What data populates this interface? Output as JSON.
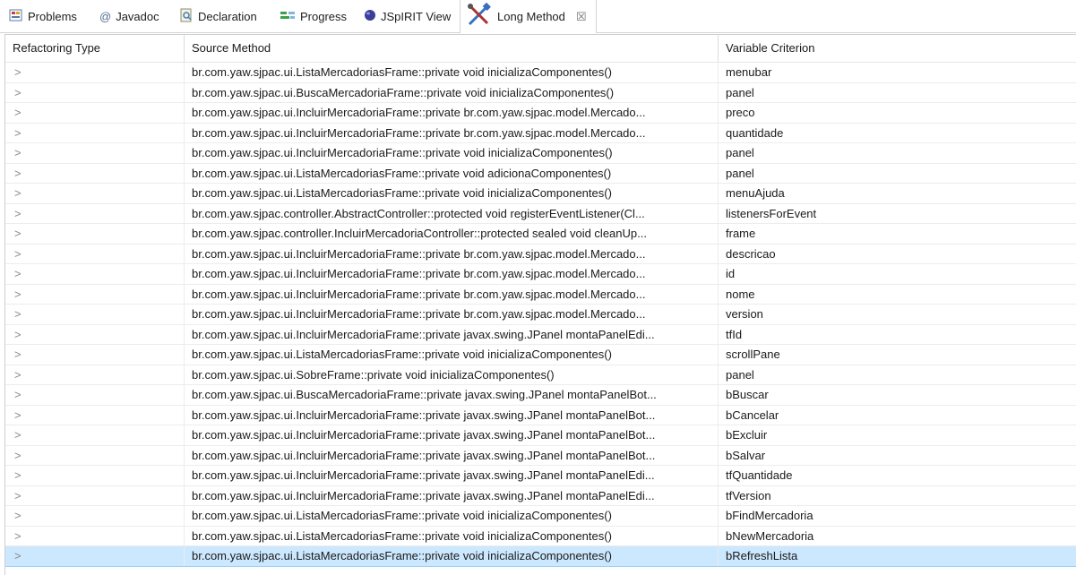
{
  "tabs": [
    {
      "label": "Problems",
      "icon": "problems-icon"
    },
    {
      "label": "Javadoc",
      "icon": "javadoc-icon"
    },
    {
      "label": "Declaration",
      "icon": "declaration-icon"
    },
    {
      "label": "Progress",
      "icon": "progress-icon"
    },
    {
      "label": "JSpIRIT View",
      "icon": "jspirit-icon"
    },
    {
      "label": "Long Method",
      "icon": "tools-icon",
      "active": true,
      "close": "☒"
    }
  ],
  "table": {
    "columns": [
      "Refactoring Type",
      "Source Method",
      "Variable Criterion"
    ],
    "expander": ">",
    "rows": [
      {
        "method": "br.com.yaw.sjpac.ui.ListaMercadoriasFrame::private void inicializaComponentes()",
        "criterion": "menubar"
      },
      {
        "method": "br.com.yaw.sjpac.ui.BuscaMercadoriaFrame::private void inicializaComponentes()",
        "criterion": "panel"
      },
      {
        "method": "br.com.yaw.sjpac.ui.IncluirMercadoriaFrame::private br.com.yaw.sjpac.model.Mercado...",
        "criterion": "preco"
      },
      {
        "method": "br.com.yaw.sjpac.ui.IncluirMercadoriaFrame::private br.com.yaw.sjpac.model.Mercado...",
        "criterion": "quantidade"
      },
      {
        "method": "br.com.yaw.sjpac.ui.IncluirMercadoriaFrame::private void inicializaComponentes()",
        "criterion": "panel"
      },
      {
        "method": "br.com.yaw.sjpac.ui.ListaMercadoriasFrame::private void adicionaComponentes()",
        "criterion": "panel"
      },
      {
        "method": "br.com.yaw.sjpac.ui.ListaMercadoriasFrame::private void inicializaComponentes()",
        "criterion": "menuAjuda"
      },
      {
        "method": "br.com.yaw.sjpac.controller.AbstractController::protected void registerEventListener(Cl...",
        "criterion": "listenersForEvent"
      },
      {
        "method": "br.com.yaw.sjpac.controller.IncluirMercadoriaController::protected sealed void cleanUp...",
        "criterion": "frame"
      },
      {
        "method": "br.com.yaw.sjpac.ui.IncluirMercadoriaFrame::private br.com.yaw.sjpac.model.Mercado...",
        "criterion": "descricao"
      },
      {
        "method": "br.com.yaw.sjpac.ui.IncluirMercadoriaFrame::private br.com.yaw.sjpac.model.Mercado...",
        "criterion": "id"
      },
      {
        "method": "br.com.yaw.sjpac.ui.IncluirMercadoriaFrame::private br.com.yaw.sjpac.model.Mercado...",
        "criterion": "nome"
      },
      {
        "method": "br.com.yaw.sjpac.ui.IncluirMercadoriaFrame::private br.com.yaw.sjpac.model.Mercado...",
        "criterion": "version"
      },
      {
        "method": "br.com.yaw.sjpac.ui.IncluirMercadoriaFrame::private javax.swing.JPanel montaPanelEdi...",
        "criterion": "tfId"
      },
      {
        "method": "br.com.yaw.sjpac.ui.ListaMercadoriasFrame::private void inicializaComponentes()",
        "criterion": "scrollPane"
      },
      {
        "method": "br.com.yaw.sjpac.ui.SobreFrame::private void inicializaComponentes()",
        "criterion": "panel"
      },
      {
        "method": "br.com.yaw.sjpac.ui.BuscaMercadoriaFrame::private javax.swing.JPanel montaPanelBot...",
        "criterion": "bBuscar"
      },
      {
        "method": "br.com.yaw.sjpac.ui.IncluirMercadoriaFrame::private javax.swing.JPanel montaPanelBot...",
        "criterion": "bCancelar"
      },
      {
        "method": "br.com.yaw.sjpac.ui.IncluirMercadoriaFrame::private javax.swing.JPanel montaPanelBot...",
        "criterion": "bExcluir"
      },
      {
        "method": "br.com.yaw.sjpac.ui.IncluirMercadoriaFrame::private javax.swing.JPanel montaPanelBot...",
        "criterion": "bSalvar"
      },
      {
        "method": "br.com.yaw.sjpac.ui.IncluirMercadoriaFrame::private javax.swing.JPanel montaPanelEdi...",
        "criterion": "tfQuantidade"
      },
      {
        "method": "br.com.yaw.sjpac.ui.IncluirMercadoriaFrame::private javax.swing.JPanel montaPanelEdi...",
        "criterion": "tfVersion"
      },
      {
        "method": "br.com.yaw.sjpac.ui.ListaMercadoriasFrame::private void inicializaComponentes()",
        "criterion": "bFindMercadoria"
      },
      {
        "method": "br.com.yaw.sjpac.ui.ListaMercadoriasFrame::private void inicializaComponentes()",
        "criterion": "bNewMercadoria"
      },
      {
        "method": "br.com.yaw.sjpac.ui.ListaMercadoriasFrame::private void inicializaComponentes()",
        "criterion": "bRefreshLista",
        "selected": true
      }
    ]
  },
  "colors": {
    "selected_row": "#cce8ff",
    "border": "#d4d4d4"
  }
}
